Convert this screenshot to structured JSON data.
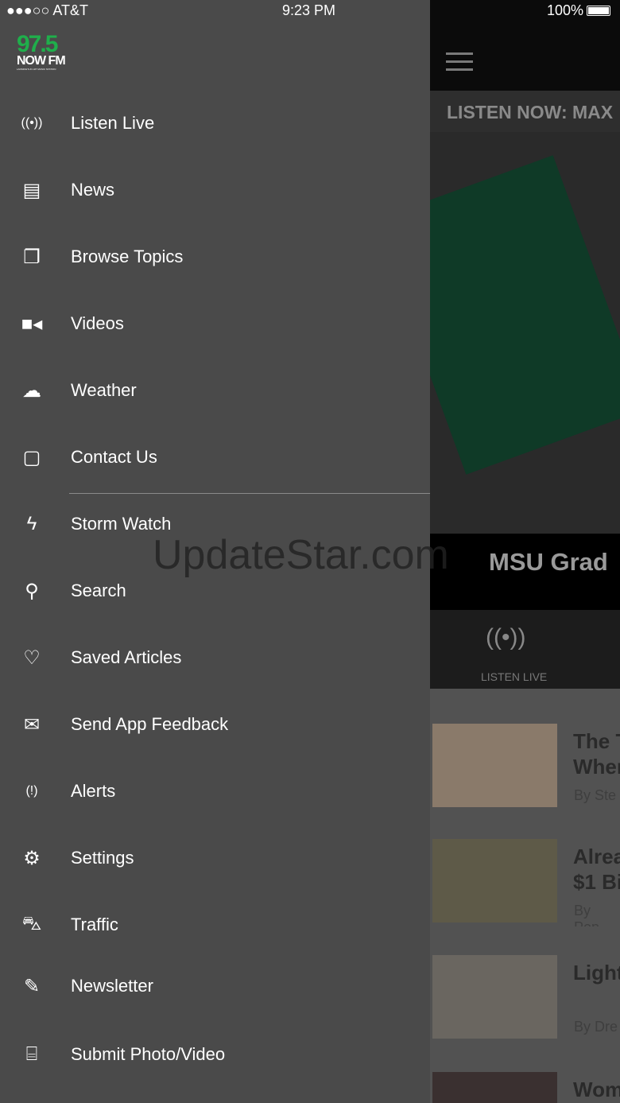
{
  "status": {
    "carrier": "●●●○○ AT&T",
    "time": "9:23 PM",
    "battery": "100%"
  },
  "logo": {
    "number": "97.5",
    "name": "NOW FM",
    "tagline": "LANSING'S #1 HIT MUSIC STATION"
  },
  "menu": [
    {
      "label": "Listen Live",
      "icon": "broadcast-icon"
    },
    {
      "label": "News",
      "icon": "document-icon"
    },
    {
      "label": "Browse Topics",
      "icon": "copy-icon"
    },
    {
      "label": "Videos",
      "icon": "video-camera-icon"
    },
    {
      "label": "Weather",
      "icon": "weather-icon"
    },
    {
      "label": "Contact Us",
      "icon": "chat-bubble-icon"
    },
    {
      "label": "Storm Watch",
      "icon": "storm-icon"
    },
    {
      "label": "Search",
      "icon": "search-icon"
    },
    {
      "label": "Saved Articles",
      "icon": "heart-icon"
    },
    {
      "label": "Send App Feedback",
      "icon": "envelope-icon"
    },
    {
      "label": "Alerts",
      "icon": "alert-icon"
    },
    {
      "label": "Settings",
      "icon": "gear-icon"
    },
    {
      "label": "Traffic",
      "icon": "car-icon"
    },
    {
      "label": "Newsletter",
      "icon": "pencil-icon"
    },
    {
      "label": "Submit Photo/Video",
      "icon": "camera-icon"
    }
  ],
  "main": {
    "ticker": "LISTEN NOW: MAX",
    "hero_caption": "MSU Grad",
    "tab_label": "LISTEN LIVE",
    "articles": [
      {
        "title1": "The T",
        "title2": "Wher",
        "byline": "By Ste"
      },
      {
        "title1": "Alrea",
        "title2": "$1 Bi",
        "byline": "By Pop"
      },
      {
        "title1": "Light",
        "title2": "",
        "byline": "By Dre"
      },
      {
        "title1": "Wom",
        "title2": "",
        "byline": ""
      }
    ]
  },
  "watermark": "UpdateStar.com"
}
